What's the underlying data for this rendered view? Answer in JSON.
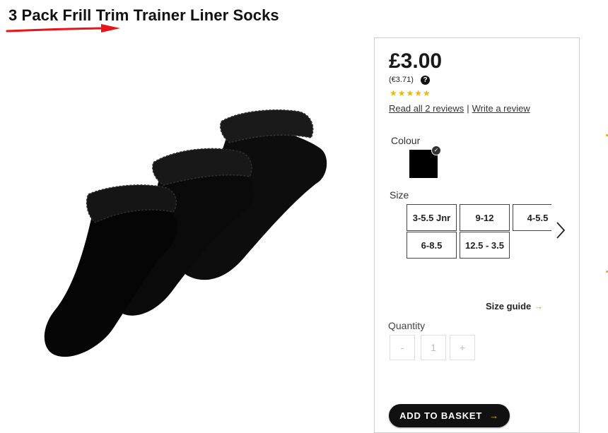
{
  "product": {
    "title": "3 Pack Frill Trim Trainer Liner Socks",
    "price": "£3.00",
    "euro_price": "(€3.71)",
    "rating_stars": "★★★★★",
    "rating_value": 5,
    "reviews_link": "Read all 2 reviews",
    "review_separator": "|",
    "write_review_link": "Write a review"
  },
  "colour": {
    "label": "Colour",
    "selected_color": "#000000"
  },
  "size": {
    "label": "Size",
    "options": [
      "3-5.5 Jnr",
      "9-12",
      "4-5.5",
      "6-8.5",
      "12.5 - 3.5"
    ]
  },
  "size_guide": {
    "label": "Size guide",
    "arrow": "→"
  },
  "quantity": {
    "label": "Quantity",
    "decrease": "-",
    "value": "1",
    "increase": "+"
  },
  "basket": {
    "label": "ADD TO BASKET",
    "arrow": "→"
  },
  "icons": {
    "help": "?",
    "check": "✓"
  },
  "colors": {
    "accent_yellow": "#f2b705",
    "annotation_red": "#e8141a",
    "button_black": "#111111"
  }
}
